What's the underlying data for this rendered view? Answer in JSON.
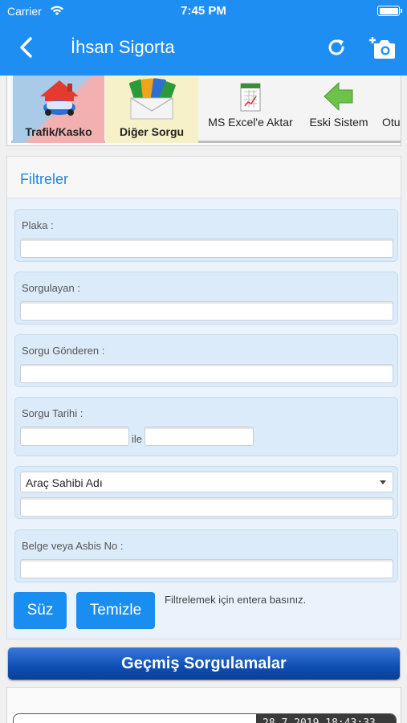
{
  "status": {
    "carrier": "Carrier",
    "time": "7:45 PM"
  },
  "nav": {
    "title": "İhsan Sigorta"
  },
  "toolbar": {
    "items": [
      {
        "label": "Trafik/Kasko",
        "icon": "car-house-icon"
      },
      {
        "label": "Diğer Sorgu",
        "icon": "envelope-cards-icon"
      },
      {
        "label": "MS Excel'e Aktar",
        "icon": "excel-sheet-icon"
      },
      {
        "label": "Eski Sistem",
        "icon": "green-arrow-left-icon"
      },
      {
        "label": "Otu"
      }
    ]
  },
  "filters": {
    "title": "Filtreler",
    "plaka_label": "Plaka :",
    "sorgulayan_label": "Sorgulayan :",
    "gonderen_label": "Sorgu Gönderen :",
    "tarih_label": "Sorgu Tarihi :",
    "tarih_between": "ile",
    "select_value": "Araç Sahibi Adı",
    "belge_label": "Belge veya Asbis No :",
    "btn_suz": "Süz",
    "btn_temizle": "Temizle",
    "hint": "Filtrelemek için entera basınız."
  },
  "history": {
    "title": "Geçmiş Sorgulamalar",
    "record_date": "28.7.2019 18:43:33"
  },
  "colors": {
    "accent": "#1f8ef3",
    "panel": "#eaf3fc",
    "history_bar": "#0e4fb5"
  }
}
